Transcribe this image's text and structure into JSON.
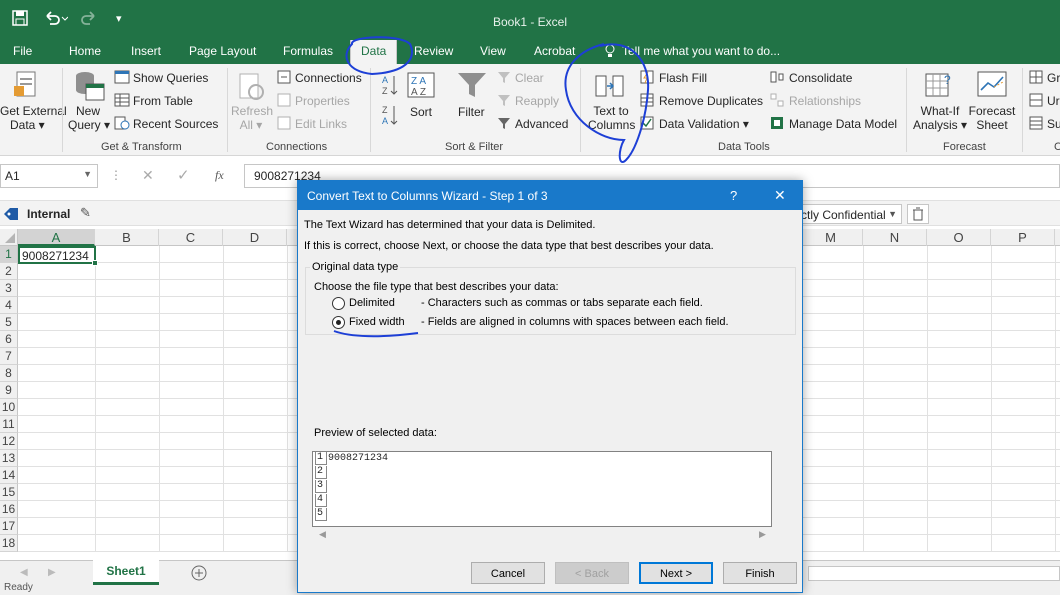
{
  "window": {
    "title": "Book1 - Excel"
  },
  "tabs": [
    "File",
    "Home",
    "Insert",
    "Page Layout",
    "Formulas",
    "Data",
    "Review",
    "View",
    "Acrobat"
  ],
  "active_tab": "Data",
  "tell_me": "Tell me what you want to do...",
  "ribbon": {
    "get_transform": {
      "group_label": "Get & Transform",
      "get_external": [
        "Get External",
        "Data ▾"
      ],
      "new_query": [
        "New",
        "Query ▾"
      ],
      "show_queries": "Show Queries",
      "from_table": "From Table",
      "recent_sources": "Recent Sources"
    },
    "connections": {
      "group_label": "Connections",
      "refresh": [
        "Refresh",
        "All ▾"
      ],
      "connections": "Connections",
      "properties": "Properties",
      "edit_links": "Edit Links"
    },
    "sort_filter": {
      "group_label": "Sort & Filter",
      "sort": "Sort",
      "filter": "Filter",
      "clear": "Clear",
      "reapply": "Reapply",
      "advanced": "Advanced"
    },
    "data_tools": {
      "group_label": "Data Tools",
      "text_to_columns": [
        "Text to",
        "Columns"
      ],
      "flash_fill": "Flash Fill",
      "remove_duplicates": "Remove Duplicates",
      "data_validation": "Data Validation ▾",
      "consolidate": "Consolidate",
      "relationships": "Relationships",
      "manage_data_model": "Manage Data Model"
    },
    "forecast": {
      "group_label": "Forecast",
      "what_if": [
        "What-If",
        "Analysis ▾"
      ],
      "forecast_sheet": [
        "Forecast",
        "Sheet"
      ]
    },
    "outline_partial": [
      "Gr",
      "Ur",
      "Su"
    ],
    "outline_group_partial": "C"
  },
  "formula_bar": {
    "name_box": "A1",
    "fx": "fx",
    "value": "9008271234"
  },
  "sensitivity": {
    "label": "Internal",
    "confidential": "ctly Confidential"
  },
  "grid": {
    "columns": [
      "A",
      "B",
      "C",
      "D",
      "M",
      "N",
      "O",
      "P"
    ],
    "rows": [
      "1",
      "2",
      "3",
      "4",
      "5",
      "6",
      "7",
      "8",
      "9",
      "10",
      "11",
      "12",
      "13",
      "14",
      "15",
      "16",
      "17",
      "18"
    ],
    "a1": "9008271234"
  },
  "sheets": {
    "active": "Sheet1"
  },
  "status": {
    "text": "Ready"
  },
  "dialog": {
    "title": "Convert Text to Columns Wizard - Step 1 of 3",
    "help": "?",
    "close": "✕",
    "intro1": "The Text Wizard has determined that your data is Delimited.",
    "intro2": "If this is correct, choose Next, or choose the data type that best describes your data.",
    "group_title": "Original data type",
    "choose": "Choose the file type that best describes your data:",
    "options": [
      {
        "label": "Delimited",
        "desc": "- Characters such as commas or tabs separate each field.",
        "selected": false
      },
      {
        "label": "Fixed width",
        "desc": "- Fields are aligned in columns with spaces between each field.",
        "selected": true
      }
    ],
    "preview_label": "Preview of selected data:",
    "preview_rows": [
      "1",
      "2",
      "3",
      "4",
      "5"
    ],
    "preview_first": "9008271234",
    "buttons": {
      "cancel": "Cancel",
      "back": "< Back",
      "next": "Next >",
      "finish": "Finish"
    }
  }
}
